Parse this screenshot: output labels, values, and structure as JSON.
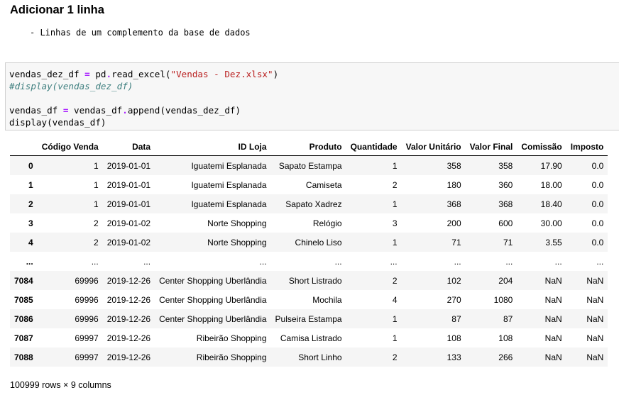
{
  "markdown": {
    "heading": "Adicionar 1 linha",
    "bullet": "- Linhas de um complemento da base de dados"
  },
  "code_cell": {
    "lines": [
      [
        {
          "t": "vendas_dez_df ",
          "c": ""
        },
        {
          "t": "=",
          "c": "op"
        },
        {
          "t": " pd",
          "c": ""
        },
        {
          "t": ".",
          "c": "op"
        },
        {
          "t": "read_excel(",
          "c": ""
        },
        {
          "t": "\"Vendas - Dez.xlsx\"",
          "c": "str"
        },
        {
          "t": ")",
          "c": ""
        }
      ],
      [
        {
          "t": "#display(vendas_dez_df)",
          "c": "cm"
        }
      ],
      [],
      [
        {
          "t": "vendas_df ",
          "c": ""
        },
        {
          "t": "=",
          "c": "op"
        },
        {
          "t": " vendas_df",
          "c": ""
        },
        {
          "t": ".",
          "c": "op"
        },
        {
          "t": "append(vendas_dez_df)",
          "c": ""
        }
      ],
      [
        {
          "t": "display(vendas_df)",
          "c": ""
        }
      ]
    ]
  },
  "dataframe": {
    "columns": [
      "",
      "Código Venda",
      "Data",
      "ID Loja",
      "Produto",
      "Quantidade",
      "Valor Unitário",
      "Valor Final",
      "Comissão",
      "Imposto"
    ],
    "rows": [
      [
        "0",
        "1",
        "2019-01-01",
        "Iguatemi Esplanada",
        "Sapato Estampa",
        "1",
        "358",
        "358",
        "17.90",
        "0.0"
      ],
      [
        "1",
        "1",
        "2019-01-01",
        "Iguatemi Esplanada",
        "Camiseta",
        "2",
        "180",
        "360",
        "18.00",
        "0.0"
      ],
      [
        "2",
        "1",
        "2019-01-01",
        "Iguatemi Esplanada",
        "Sapato Xadrez",
        "1",
        "368",
        "368",
        "18.40",
        "0.0"
      ],
      [
        "3",
        "2",
        "2019-01-02",
        "Norte Shopping",
        "Relógio",
        "3",
        "200",
        "600",
        "30.00",
        "0.0"
      ],
      [
        "4",
        "2",
        "2019-01-02",
        "Norte Shopping",
        "Chinelo Liso",
        "1",
        "71",
        "71",
        "3.55",
        "0.0"
      ],
      [
        "...",
        "...",
        "...",
        "...",
        "...",
        "...",
        "...",
        "...",
        "...",
        "..."
      ],
      [
        "7084",
        "69996",
        "2019-12-26",
        "Center Shopping Uberlândia",
        "Short Listrado",
        "2",
        "102",
        "204",
        "NaN",
        "NaN"
      ],
      [
        "7085",
        "69996",
        "2019-12-26",
        "Center Shopping Uberlândia",
        "Mochila",
        "4",
        "270",
        "1080",
        "NaN",
        "NaN"
      ],
      [
        "7086",
        "69996",
        "2019-12-26",
        "Center Shopping Uberlândia",
        "Pulseira Estampa",
        "1",
        "87",
        "87",
        "NaN",
        "NaN"
      ],
      [
        "7087",
        "69997",
        "2019-12-26",
        "Ribeirão Shopping",
        "Camisa Listrado",
        "1",
        "108",
        "108",
        "NaN",
        "NaN"
      ],
      [
        "7088",
        "69997",
        "2019-12-26",
        "Ribeirão Shopping",
        "Short Linho",
        "2",
        "133",
        "266",
        "NaN",
        "NaN"
      ]
    ],
    "shape_text": "100999 rows × 9 columns"
  }
}
